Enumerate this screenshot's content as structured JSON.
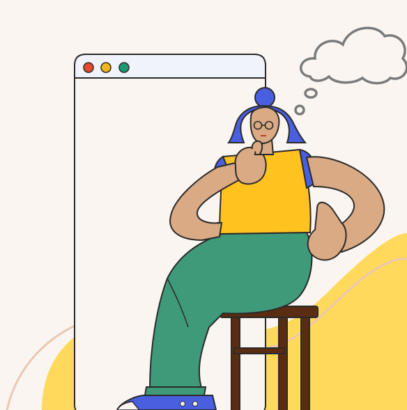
{
  "scene": {
    "description_visible_text": ""
  },
  "colors": {
    "background": "#faf5f0",
    "yellow_blob": "#ffd95c",
    "window_frame": "#f1f3fa",
    "dot_red": "#e6492d",
    "dot_yellow": "#f2b51c",
    "dot_green": "#1e9a72",
    "hair_blue": "#4a5fe0",
    "skin": "#d9aa84",
    "shirt_yellow": "#ffc21f",
    "pants_green": "#3f9a7a",
    "chair_brown": "#5a2d12",
    "outline": "#2a2a2a",
    "cloud_stroke": "#7a7a7a",
    "swirl": "#ecc7b0"
  },
  "icons": {
    "window_controls": [
      "close-dot",
      "minimize-dot",
      "maximize-dot"
    ],
    "thought": "thought-cloud-icon"
  }
}
